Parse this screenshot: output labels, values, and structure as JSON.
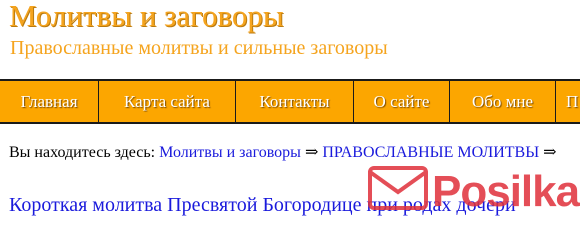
{
  "header": {
    "title": "Молитвы и заговоры",
    "tagline": "Православные молитвы и сильные заговоры"
  },
  "nav": {
    "items": [
      {
        "label": "Главная"
      },
      {
        "label": "Карта сайта"
      },
      {
        "label": "Контакты"
      },
      {
        "label": "О сайте"
      },
      {
        "label": "Обо мне"
      },
      {
        "label": "П"
      }
    ]
  },
  "breadcrumb": {
    "prefix": "Вы находитесь здесь:",
    "crumbs": [
      "Молитвы и заговоры",
      "ПРАВОСЛАВНЫЕ МОЛИТВЫ"
    ],
    "separator": "⇒"
  },
  "article": {
    "title": "Короткая молитва Пресвятой Богородице при родах дочери"
  },
  "watermark": {
    "brand": "Posilka",
    "icon": "envelope-icon"
  },
  "colors": {
    "accent": "#f5a41e",
    "nav_bg": "#fca600",
    "link": "#1a1adc",
    "watermark": "#e0303a"
  }
}
